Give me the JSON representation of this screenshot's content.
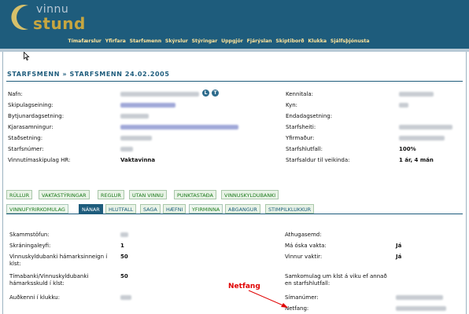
{
  "logo": {
    "line1": "vinnu",
    "line2": "stund"
  },
  "nav": [
    "Tímafærslur",
    "Yfirfara",
    "Starfsmenn",
    "Skýrslur",
    "Stýringar",
    "Uppgjör",
    "Fjárýslan",
    "Skiptiborð",
    "Klukka",
    "Sjálfsþjónusta"
  ],
  "page_title": "STARFSMENN » STARFSMENN 24.02.2005",
  "badges": [
    "L",
    "T"
  ],
  "left_fields": [
    {
      "label": "Nafn:",
      "value": ""
    },
    {
      "label": "Skipulagseining:",
      "value": ""
    },
    {
      "label": "Bytjunardagsetning:",
      "value": ""
    },
    {
      "label": "Kjarasamningur:",
      "value": ""
    },
    {
      "label": "Staðsetning:",
      "value": ""
    },
    {
      "label": "Starfsnúmer:",
      "value": ""
    },
    {
      "label": "Vinnutímaskipulag HR:",
      "value": "Vaktavinna"
    }
  ],
  "right_fields": [
    {
      "label": "Kennitala:",
      "value": ""
    },
    {
      "label": "Kyn:",
      "value": ""
    },
    {
      "label": "Endadagsetning:",
      "value": ""
    },
    {
      "label": "Starfsheiti:",
      "value": ""
    },
    {
      "label": "Yfirmaður:",
      "value": ""
    },
    {
      "label": "Starfshlutfall:",
      "value": "100%"
    },
    {
      "label": "Starfsaldur til veikinda:",
      "value": "1 ár, 4 mán"
    }
  ],
  "tabs_row1": [
    "RÚLLUR",
    "VAKTASTÝRINGAR",
    "REGLUR",
    "UTAN VINNU",
    "PUNKTASTAÐA",
    "VINNUSKYLDUBANKI"
  ],
  "tabs_row2": [
    "VINNUFYRIRKOMULAG",
    "NÁNAR",
    "HLUTFALL",
    "SAGA",
    "HÆFNI",
    "YFIRMINNA",
    "ABGANGUR",
    "STIMPILKLUKKUR"
  ],
  "detail_left": [
    {
      "label": "Skammstöfun:",
      "value": ""
    },
    {
      "label": "Skráningaleyfi:",
      "value": "1"
    },
    {
      "label": "Vinnuskyldubanki hámarksinneign í klst:",
      "value": "50"
    },
    {
      "label": "Tímabanki/Vinnuskyldubanki hámarksskuld í klst:",
      "value": "50"
    },
    {
      "label": "Auðkenni í klukku:",
      "value": ""
    }
  ],
  "detail_right": [
    {
      "label": "Athugasemd:",
      "value": ""
    },
    {
      "label": "Má óska vakta:",
      "value": "Já"
    },
    {
      "label": "Vinnur vaktir:",
      "value": "Já"
    },
    {
      "label": "Samkomulag um klst á viku ef annað en starfshlutfall:",
      "value": ""
    },
    {
      "label": "Símanúmer:",
      "value": ""
    },
    {
      "label": "Netfang:",
      "value": ""
    }
  ],
  "annotation": "Netfang",
  "colors": {
    "header": "#1e5c7c",
    "nav_text": "#ffe49a",
    "logo_gold": "#c7a640",
    "tab_green": "#1a7a1a",
    "annotation_red": "#e00000"
  }
}
